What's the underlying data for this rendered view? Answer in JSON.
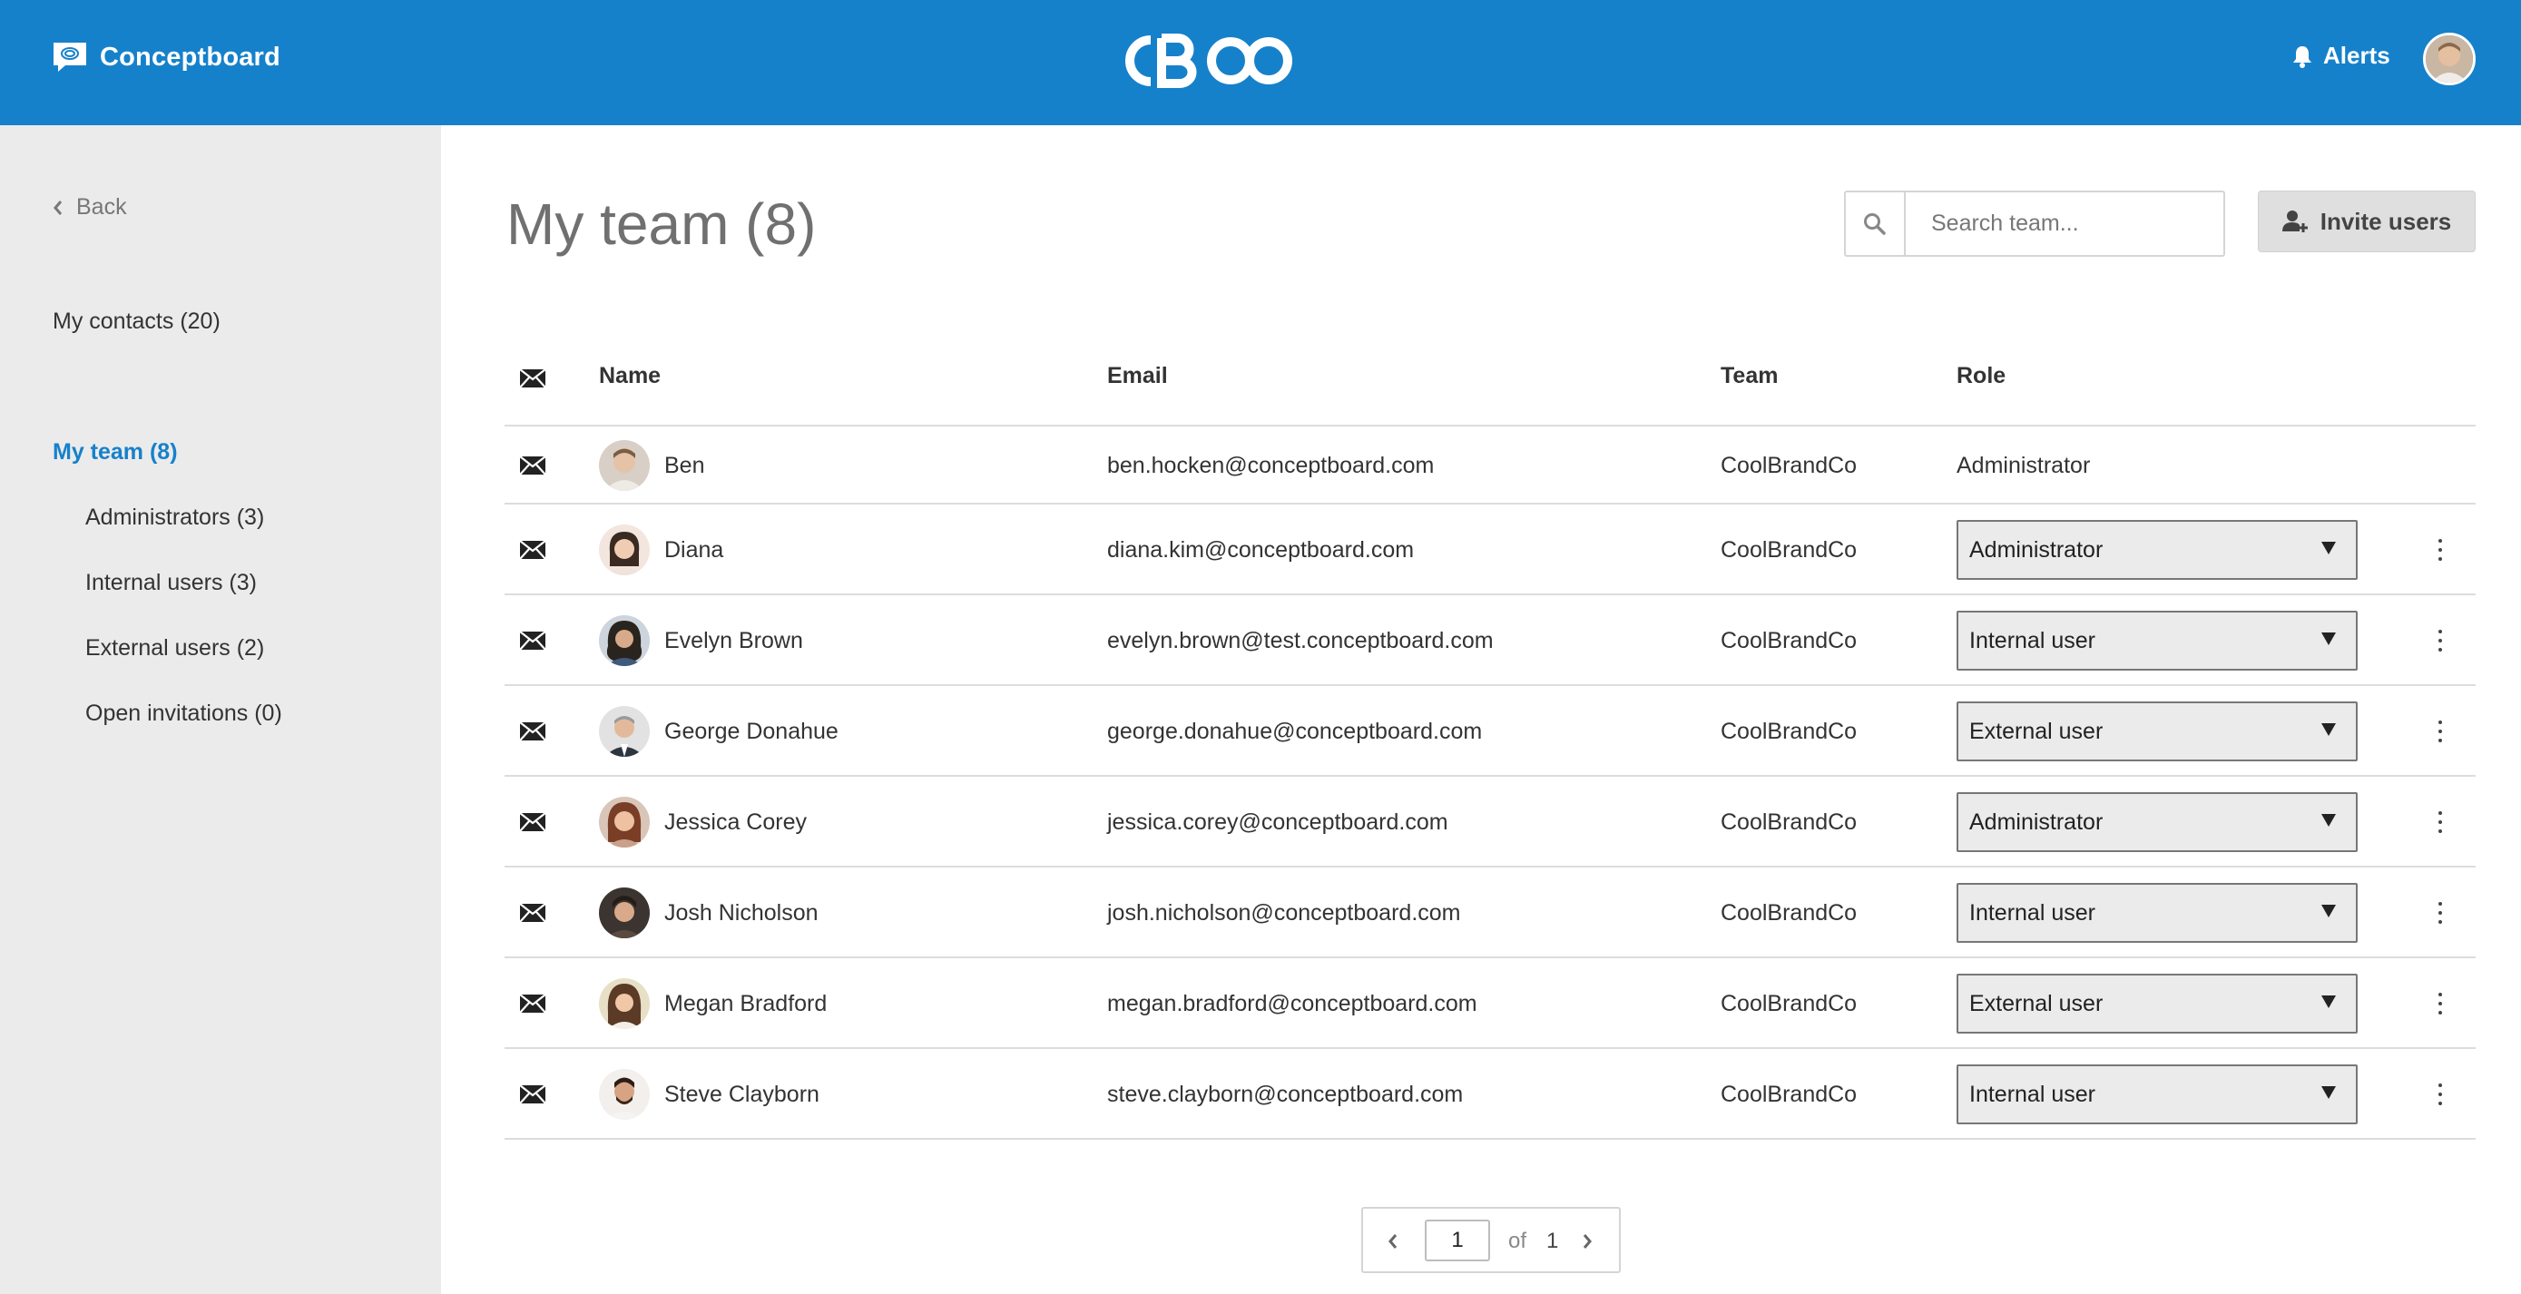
{
  "header": {
    "brand": "Conceptboard",
    "alerts_label": "Alerts",
    "background_color": "#1681cb"
  },
  "sidebar": {
    "back_label": "Back",
    "contacts_label": "My contacts (20)",
    "team_label": "My team (8)",
    "sub_items": [
      {
        "label": "Administrators (3)"
      },
      {
        "label": "Internal users (3)"
      },
      {
        "label": "External users (2)"
      },
      {
        "label": "Open invitations (0)"
      }
    ]
  },
  "main": {
    "title": "My team (8)",
    "search_placeholder": "Search team...",
    "invite_label": "Invite users"
  },
  "table": {
    "columns": [
      "Name",
      "Email",
      "Team",
      "Role"
    ],
    "rows": [
      {
        "name": "Ben",
        "email": "ben.hocken@conceptboard.com",
        "team": "CoolBrandCo",
        "role": "Administrator",
        "editable": false
      },
      {
        "name": "Diana",
        "email": "diana.kim@conceptboard.com",
        "team": "CoolBrandCo",
        "role": "Administrator",
        "editable": true
      },
      {
        "name": "Evelyn Brown",
        "email": "evelyn.brown@test.conceptboard.com",
        "team": "CoolBrandCo",
        "role": "Internal user",
        "editable": true
      },
      {
        "name": "George Donahue",
        "email": "george.donahue@conceptboard.com",
        "team": "CoolBrandCo",
        "role": "External user",
        "editable": true
      },
      {
        "name": "Jessica Corey",
        "email": "jessica.corey@conceptboard.com",
        "team": "CoolBrandCo",
        "role": "Administrator",
        "editable": true
      },
      {
        "name": "Josh Nicholson",
        "email": "josh.nicholson@conceptboard.com",
        "team": "CoolBrandCo",
        "role": "Internal user",
        "editable": true
      },
      {
        "name": "Megan Bradford",
        "email": "megan.bradford@conceptboard.com",
        "team": "CoolBrandCo",
        "role": "External user",
        "editable": true
      },
      {
        "name": "Steve Clayborn",
        "email": "steve.clayborn@conceptboard.com",
        "team": "CoolBrandCo",
        "role": "Internal user",
        "editable": true
      }
    ]
  },
  "pagination": {
    "current": "1",
    "of_label": "of",
    "total": "1"
  }
}
